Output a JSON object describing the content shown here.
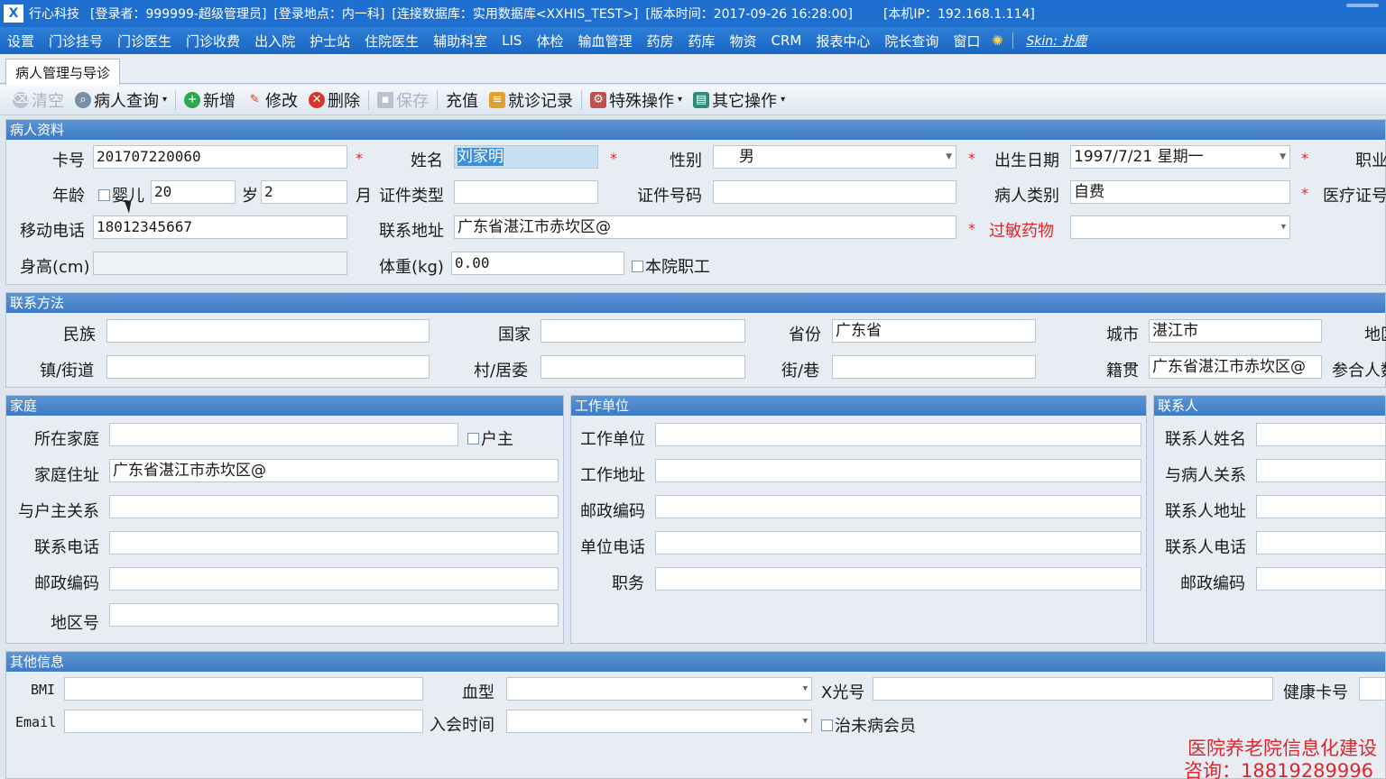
{
  "titlebar": {
    "logo": "X",
    "company": "行心科技",
    "login_user": "[登录者：999999-超级管理员]",
    "login_place": "[登录地点：内一科]",
    "database": "[连接数据库：实用数据库<XXHIS_TEST>]",
    "version": "[版本时间：2017-09-26 16:28:00]",
    "ip": "[本机IP：192.168.1.114]"
  },
  "menu": {
    "items": [
      "设置",
      "门诊挂号",
      "门诊医生",
      "门诊收费",
      "出入院",
      "护士站",
      "住院医生",
      "辅助科室",
      "LIS",
      "体检",
      "输血管理",
      "药房",
      "药库",
      "物资",
      "CRM",
      "报表中心",
      "院长查询",
      "窗口"
    ],
    "skin": "Skin: 扑鹿"
  },
  "tab": {
    "active": "病人管理与导诊"
  },
  "toolbar": {
    "clear": "清空",
    "query": "病人查询",
    "add": "新增",
    "edit": "修改",
    "delete": "删除",
    "save": "保存",
    "recharge": "充值",
    "visit_record": "就诊记录",
    "special_ops": "特殊操作",
    "other_ops": "其它操作"
  },
  "patient": {
    "title": "病人资料",
    "card_no_label": "卡号",
    "card_no": "201707220060",
    "name_label": "姓名",
    "name": "刘家明",
    "gender_label": "性别",
    "gender": "男",
    "dob_label": "出生日期",
    "dob": "1997/7/21 星期一",
    "occupation_label": "职业",
    "age_label": "年龄",
    "infant_label": "婴儿",
    "age_years": "20",
    "years_unit": "岁",
    "age_months": "2",
    "months_unit": "月",
    "id_type_label": "证件类型",
    "id_no_label": "证件号码",
    "category_label": "病人类别",
    "category": "自费",
    "insurance_label": "医疗证号",
    "mobile_label": "移动电话",
    "mobile": "18012345667",
    "address_label": "联系地址",
    "address": "广东省湛江市赤坎区@",
    "allergy_label": "过敏药物",
    "height_label": "身高(cm)",
    "weight_label": "体重(kg)",
    "weight": "0.00",
    "staff_label": "本院职工"
  },
  "contact": {
    "title": "联系方法",
    "ethnic_label": "民族",
    "country_label": "国家",
    "province_label": "省份",
    "province": "广东省",
    "city_label": "城市",
    "city": "湛江市",
    "district_label": "地区",
    "town_label": "镇/街道",
    "village_label": "村/居委",
    "street_label": "街/巷",
    "native_label": "籍贯",
    "native": "广东省湛江市赤坎区@",
    "coop_label": "参合人数"
  },
  "family": {
    "title": "家庭",
    "home_label": "所在家庭",
    "head_label": "户主",
    "home_addr_label": "家庭住址",
    "home_addr": "广东省湛江市赤坎区@",
    "relation_label": "与户主关系",
    "phone_label": "联系电话",
    "zip_label": "邮政编码",
    "area_label": "地区号"
  },
  "work": {
    "title": "工作单位",
    "unit_label": "工作单位",
    "addr_label": "工作地址",
    "zip_label": "邮政编码",
    "phone_label": "单位电话",
    "duty_label": "职务"
  },
  "contact_person": {
    "title": "联系人",
    "name_label": "联系人姓名",
    "relation_label": "与病人关系",
    "addr_label": "联系人地址",
    "phone_label": "联系人电话",
    "zip_label": "邮政编码"
  },
  "other": {
    "title": "其他信息",
    "bmi_label": "BMI",
    "blood_label": "血型",
    "xray_label": "X光号",
    "health_card_label": "健康卡号",
    "email_label": "Email",
    "join_label": "入会时间",
    "cured_label": "治未病会员"
  },
  "watermark": {
    "line1": "医院养老院信息化建设",
    "line2": "咨询：18819289996"
  }
}
